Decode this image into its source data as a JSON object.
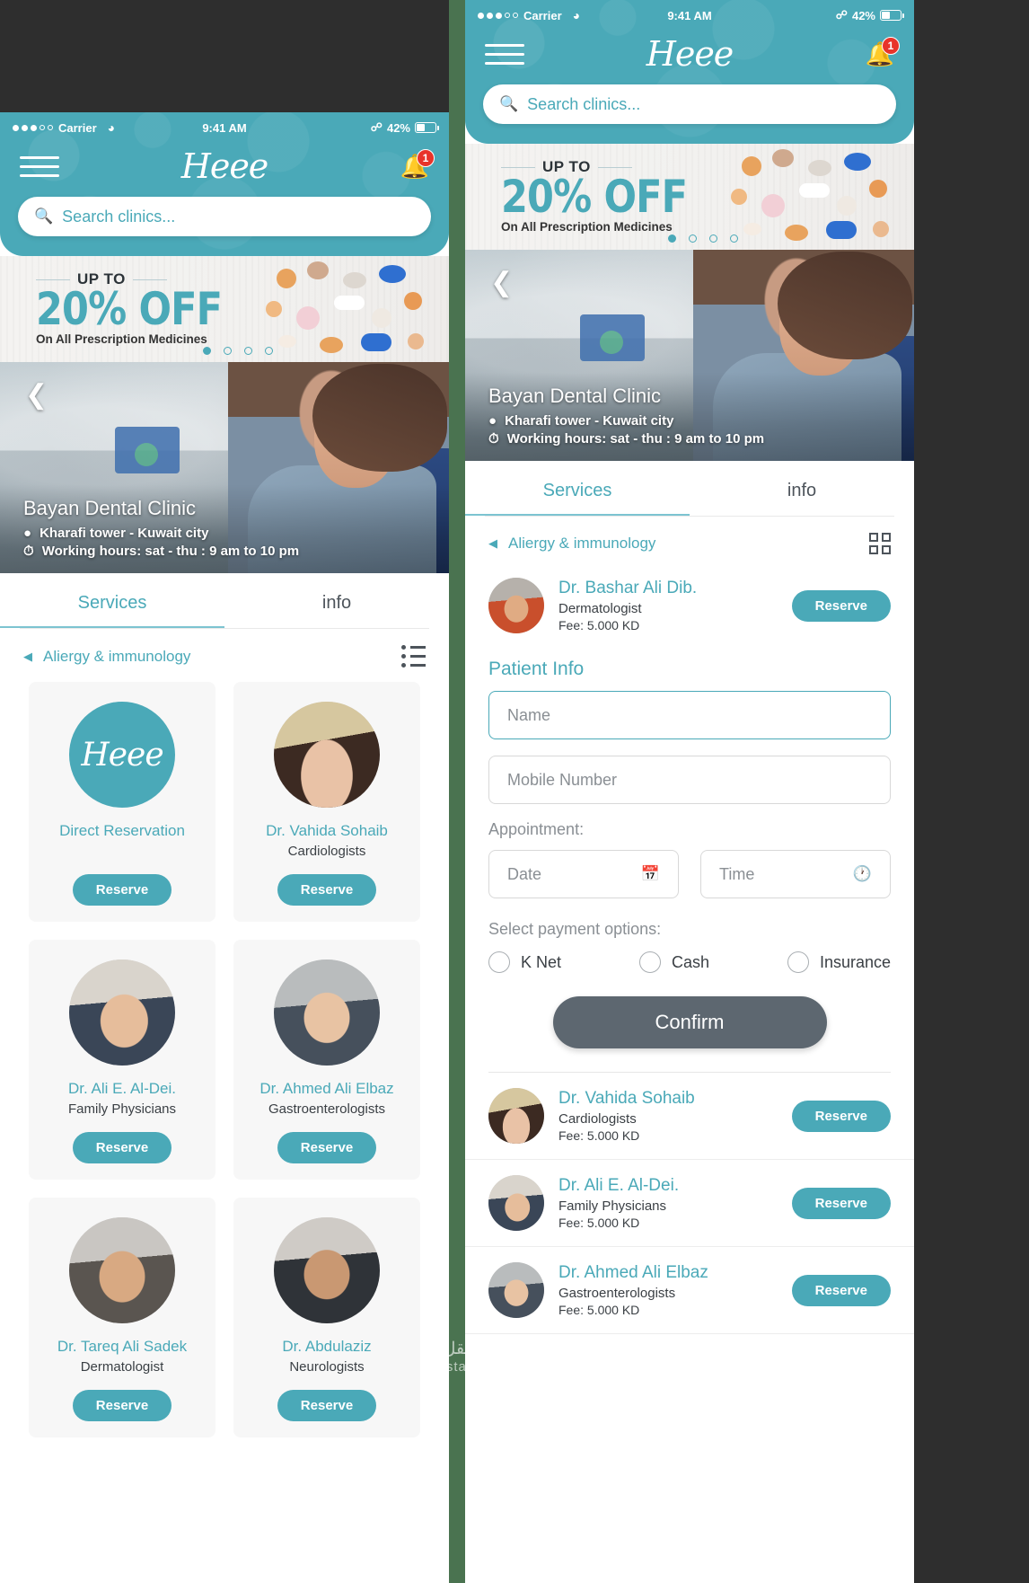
{
  "status_bar": {
    "carrier": "Carrier",
    "time": "9:41 AM",
    "battery": "42%",
    "wifi_icon": "wifi-icon",
    "bluetooth_icon": "bluetooth-icon"
  },
  "header": {
    "brand": "Heee",
    "menu_icon": "hamburger-menu-icon",
    "bell_icon": "notification-bell-icon",
    "notification_count": "1",
    "search_placeholder": "Search clinics...",
    "search_icon": "search-icon"
  },
  "promo": {
    "up_to": "UP TO",
    "discount": "20% OFF",
    "subtitle": "On All Prescription Medicines",
    "dots_total": 4,
    "dot_active_index": 0
  },
  "clinic": {
    "name": "Bayan Dental Clinic",
    "location": "Kharafi tower - Kuwait city",
    "hours": "Working hours: sat - thu : 9 am to 10 pm",
    "location_icon": "map-pin-icon",
    "clock_icon": "clock-icon",
    "back_icon": "chevron-left-icon"
  },
  "tabs": [
    {
      "label": "Services",
      "active": true
    },
    {
      "label": "info",
      "active": false
    }
  ],
  "category": {
    "label": "Aliergy & immunology",
    "arrow_icon": "chevron-left-icon",
    "view_toggle_left_icon": "list-view-icon",
    "view_toggle_right_icon": "grid-view-icon"
  },
  "reserve_label": "Reserve",
  "grid_cards": [
    {
      "name": "Direct Reservation",
      "specialty": "",
      "avatar": "logo",
      "action": "Reserve"
    },
    {
      "name": "Dr. Vahida Sohaib",
      "specialty": "Cardiologists",
      "avatar": "w1",
      "action": "Reserve"
    },
    {
      "name": "Dr. Ali E. Al-Dei.",
      "specialty": "Family Physicians",
      "avatar": "m1",
      "action": "Reserve"
    },
    {
      "name": "Dr.  Ahmed Ali Elbaz",
      "specialty": "Gastroenterologists",
      "avatar": "m2",
      "action": "Reserve"
    },
    {
      "name": "Dr. Tareq Ali Sadek",
      "specialty": "Dermatologist",
      "avatar": "m3",
      "action": "Reserve"
    },
    {
      "name": "Dr. Abdulaziz",
      "specialty": "Neurologists",
      "avatar": "m4",
      "action": "Reserve"
    }
  ],
  "selected_doctor": {
    "name": "Dr. Bashar Ali Dib.",
    "specialty": "Dermatologist",
    "fee": "Fee: 5.000 KD",
    "action": "Reserve",
    "avatar": "m5"
  },
  "patient_form": {
    "title": "Patient Info",
    "name_placeholder": "Name",
    "mobile_placeholder": "Mobile Number",
    "appointment_label": "Appointment:",
    "date_placeholder": "Date",
    "time_placeholder": "Time",
    "date_icon": "calendar-icon",
    "time_icon": "clock-icon",
    "payment_label": "Select payment options:",
    "payment_options": [
      "K Net",
      "Cash",
      "Insurance"
    ],
    "confirm_label": "Confirm"
  },
  "doctor_list": [
    {
      "name": "Dr. Vahida Sohaib",
      "specialty": "Cardiologists",
      "fee": "Fee: 5.000 KD",
      "action": "Reserve",
      "avatar": "w1"
    },
    {
      "name": "Dr. Ali E. Al-Dei.",
      "specialty": "Family Physicians",
      "fee": "Fee: 5.000 KD",
      "action": "Reserve",
      "avatar": "m1"
    },
    {
      "name": "Dr. Ahmed Ali Elbaz",
      "specialty": "Gastroenterologists",
      "fee": "Fee: 5.000 KD",
      "action": "Reserve",
      "avatar": "m2"
    }
  ],
  "watermark": {
    "arabic": "مستقل",
    "latin": "mostaql.com"
  },
  "colors": {
    "accent": "#4aa9b8",
    "badge": "#e8342a",
    "confirm": "#5d6770",
    "card_bg": "#f7f7f7"
  }
}
